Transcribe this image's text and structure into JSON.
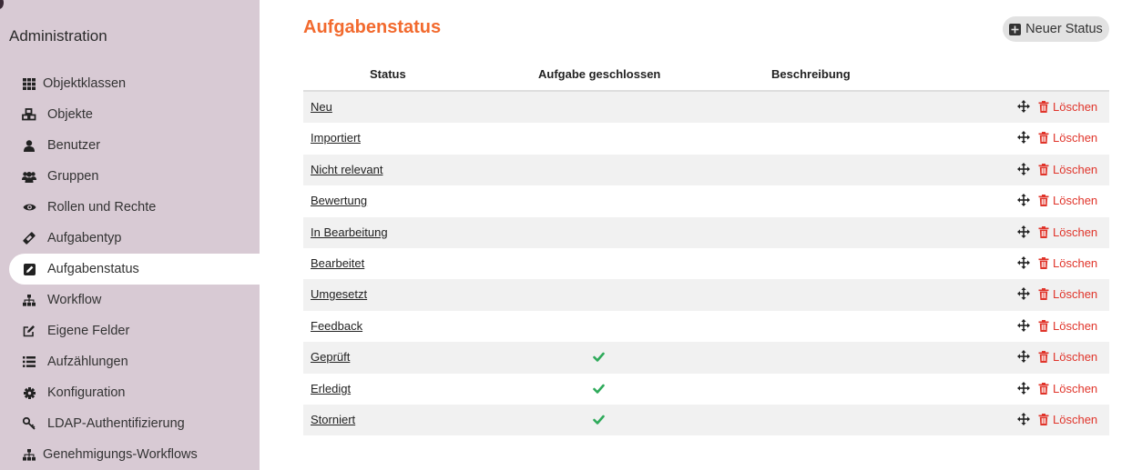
{
  "sidebar": {
    "title": "Administration",
    "items": [
      {
        "label": "Objektklassen",
        "icon": "grid-icon"
      },
      {
        "label": "Objekte",
        "icon": "cubes-icon"
      },
      {
        "label": "Benutzer",
        "icon": "user-icon"
      },
      {
        "label": "Gruppen",
        "icon": "users-icon"
      },
      {
        "label": "Rollen und Rechte",
        "icon": "eye-icon"
      },
      {
        "label": "Aufgabentyp",
        "icon": "ticket-icon"
      },
      {
        "label": "Aufgabenstatus",
        "icon": "edit-square-icon",
        "active": true
      },
      {
        "label": "Workflow",
        "icon": "sitemap-icon"
      },
      {
        "label": "Eigene Felder",
        "icon": "pen-square-icon"
      },
      {
        "label": "Aufzählungen",
        "icon": "list-icon"
      },
      {
        "label": "Konfiguration",
        "icon": "cog-icon"
      },
      {
        "label": "LDAP-Authentifizierung",
        "icon": "key-icon"
      },
      {
        "label": "Genehmigungs-Workflows",
        "icon": "sitemap-icon"
      }
    ]
  },
  "page": {
    "title": "Aufgabenstatus",
    "new_button": "Neuer Status"
  },
  "table": {
    "headers": {
      "status": "Status",
      "closed": "Aufgabe geschlossen",
      "description": "Beschreibung"
    },
    "delete_label": "Löschen",
    "rows": [
      {
        "name": "Neu",
        "closed": false
      },
      {
        "name": "Importiert",
        "closed": false
      },
      {
        "name": "Nicht relevant",
        "closed": false
      },
      {
        "name": "Bewertung",
        "closed": false
      },
      {
        "name": "In Bearbeitung",
        "closed": false
      },
      {
        "name": "Bearbeitet",
        "closed": false
      },
      {
        "name": "Umgesetzt",
        "closed": false
      },
      {
        "name": "Feedback",
        "closed": false
      },
      {
        "name": "Geprüft",
        "closed": true
      },
      {
        "name": "Erledigt",
        "closed": true
      },
      {
        "name": "Storniert",
        "closed": true
      }
    ]
  },
  "colors": {
    "accent": "#f26a2e",
    "sidebar_bg": "#d8cad4",
    "delete": "#e0342a",
    "check": "#2eaa5a"
  }
}
